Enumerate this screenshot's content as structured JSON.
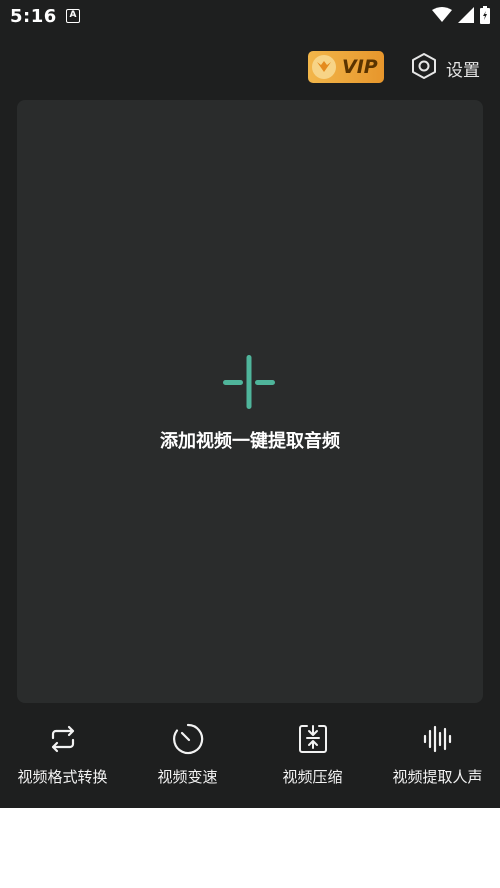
{
  "status_bar": {
    "time": "5:16",
    "notification_icon": "A"
  },
  "header": {
    "vip_label": "VIP",
    "settings_label": "设置"
  },
  "main": {
    "add_label": "添加视频一键提取音频"
  },
  "tools": [
    {
      "label": "视频格式转换",
      "icon": "convert-icon"
    },
    {
      "label": "视频变速",
      "icon": "speed-icon"
    },
    {
      "label": "视频压缩",
      "icon": "compress-icon"
    },
    {
      "label": "视频提取人声",
      "icon": "voice-wave-icon"
    }
  ],
  "colors": {
    "background": "#1e1f1f",
    "panel": "#2a2c2c",
    "accent": "#4fb59b",
    "vip_gold": "#f2b64a"
  }
}
